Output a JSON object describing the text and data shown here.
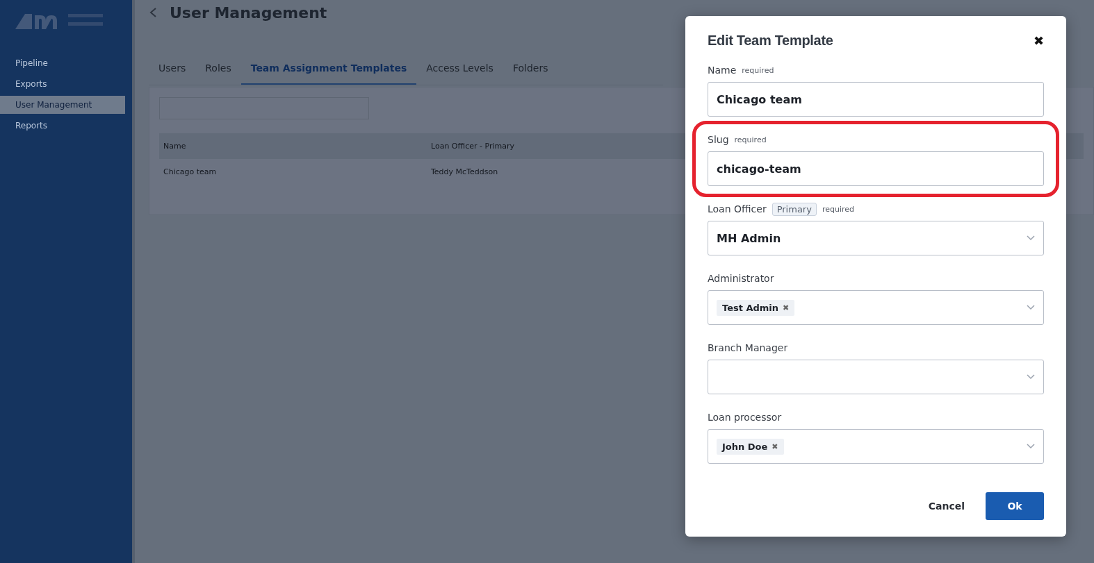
{
  "sidebar": {
    "items": [
      {
        "label": "Pipeline",
        "selected": false
      },
      {
        "label": "Exports",
        "selected": false
      },
      {
        "label": "User Management",
        "selected": true
      },
      {
        "label": "Reports",
        "selected": false
      }
    ]
  },
  "page": {
    "title": "User Management"
  },
  "tabs": [
    {
      "label": "Users",
      "selected": false
    },
    {
      "label": "Roles",
      "selected": false
    },
    {
      "label": "Team Assignment Templates",
      "selected": true
    },
    {
      "label": "Access Levels",
      "selected": false
    },
    {
      "label": "Folders",
      "selected": false
    }
  ],
  "table": {
    "columns": [
      "Name",
      "Loan Officer - Primary"
    ],
    "rows": [
      [
        "Chicago team",
        "Teddy McTeddson"
      ]
    ]
  },
  "dialog": {
    "title": "Edit Team Template",
    "close": "✖",
    "fields": [
      {
        "kind": "text",
        "label": "Name",
        "required_note": "required",
        "value": "Chicago team",
        "highlighted": false
      },
      {
        "kind": "text",
        "label": "Slug",
        "required_note": "required",
        "value": "chicago-team",
        "highlighted": true
      },
      {
        "kind": "select",
        "label": "Loan Officer",
        "badge": "Primary",
        "required_note": "required",
        "value": "MH Admin",
        "highlighted": false
      },
      {
        "kind": "multiselect",
        "label": "Administrator",
        "tags": [
          {
            "label": "Test Admin",
            "remove": "✖"
          }
        ],
        "highlighted": false
      },
      {
        "kind": "multiselect",
        "label": "Branch Manager",
        "highlighted": false
      },
      {
        "kind": "multiselect",
        "label": "Loan processor",
        "tags": [
          {
            "label": "John Doe",
            "remove": "✖"
          }
        ],
        "highlighted": false
      }
    ],
    "buttons": [
      {
        "kind": "text",
        "label": "Cancel"
      },
      {
        "kind": "primary",
        "label": "Ok"
      }
    ]
  }
}
